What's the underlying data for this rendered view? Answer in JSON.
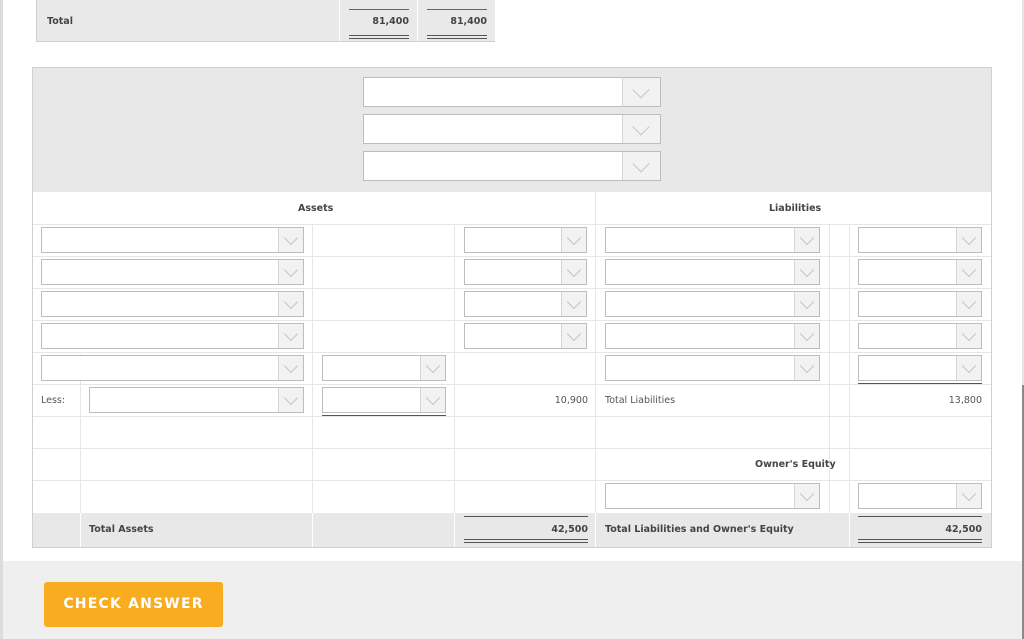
{
  "top_table": {
    "label": "Total",
    "value_1": "81,400",
    "value_2": "81,400"
  },
  "balance_sheet": {
    "assets_title": "Assets",
    "liabilities_title": "Liabilities",
    "less_label": "Less:",
    "less_value": "10,900",
    "total_liabilities_label": "Total Liabilities",
    "total_liabilities_value": "13,800",
    "owners_equity_title": "Owner's Equity",
    "total_assets_label": "Total Assets",
    "total_assets_value": "42,500",
    "total_liab_equity_label": "Total Liabilities and Owner's Equity",
    "total_liab_equity_value": "42,500"
  },
  "actions": {
    "check_answer_label": "CHECK ANSWER"
  },
  "colors": {
    "accent": "#f8ac1f",
    "panel_gray": "#e8e8e8"
  },
  "icons": {
    "dropdown": "chevron-down-icon"
  }
}
